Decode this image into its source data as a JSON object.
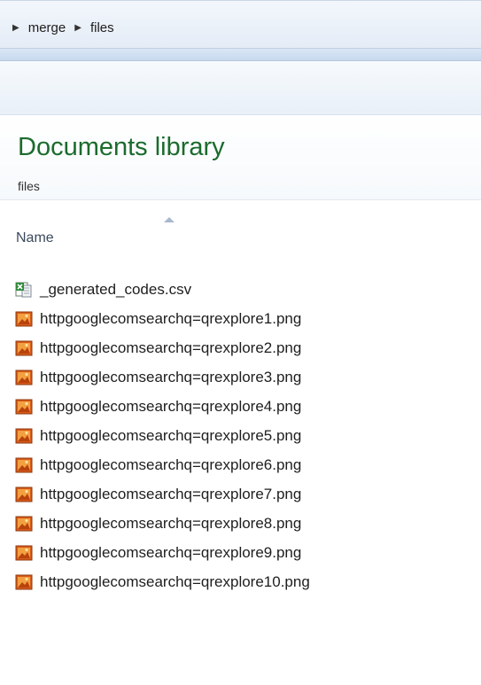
{
  "breadcrumb": {
    "items": [
      {
        "label": "merge"
      },
      {
        "label": "files"
      }
    ]
  },
  "library": {
    "title": "Documents library",
    "subtitle": "files"
  },
  "columns": {
    "name_label": "Name",
    "sort_direction": "ascending"
  },
  "files": [
    {
      "name": "_generated_codes.csv",
      "icon": "csv-file-icon"
    },
    {
      "name": "httpgooglecomsearchq=qrexplore1.png",
      "icon": "png-file-icon"
    },
    {
      "name": "httpgooglecomsearchq=qrexplore2.png",
      "icon": "png-file-icon"
    },
    {
      "name": "httpgooglecomsearchq=qrexplore3.png",
      "icon": "png-file-icon"
    },
    {
      "name": "httpgooglecomsearchq=qrexplore4.png",
      "icon": "png-file-icon"
    },
    {
      "name": "httpgooglecomsearchq=qrexplore5.png",
      "icon": "png-file-icon"
    },
    {
      "name": "httpgooglecomsearchq=qrexplore6.png",
      "icon": "png-file-icon"
    },
    {
      "name": "httpgooglecomsearchq=qrexplore7.png",
      "icon": "png-file-icon"
    },
    {
      "name": "httpgooglecomsearchq=qrexplore8.png",
      "icon": "png-file-icon"
    },
    {
      "name": "httpgooglecomsearchq=qrexplore9.png",
      "icon": "png-file-icon"
    },
    {
      "name": "httpgooglecomsearchq=qrexplore10.png",
      "icon": "png-file-icon"
    }
  ],
  "colors": {
    "library_title": "#1b6b2d",
    "address_bar": "#e4ecf6"
  }
}
